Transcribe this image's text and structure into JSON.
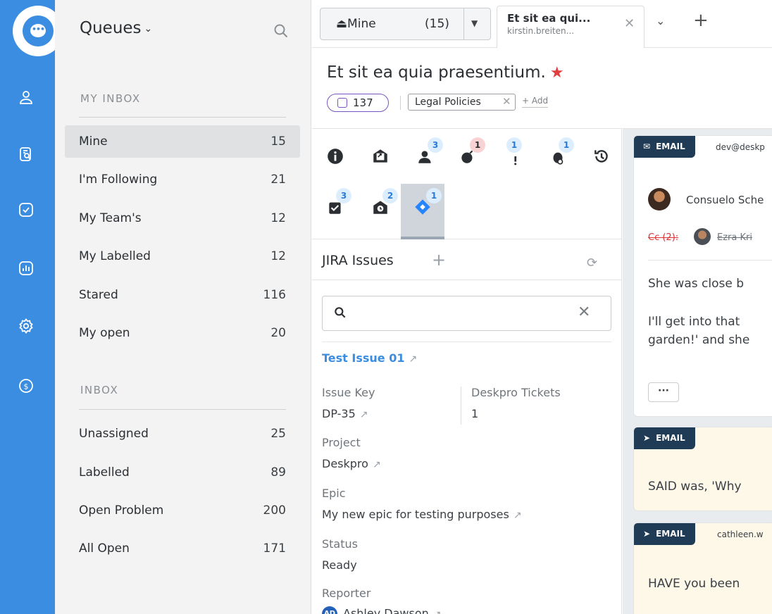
{
  "rail": {
    "icons": [
      "chat-icon",
      "user-icon",
      "tickets-search-icon",
      "tasks-check-icon",
      "reports-icon",
      "settings-icon",
      "billing-icon"
    ]
  },
  "queues": {
    "title": "Queues",
    "my_inbox_label": "MY INBOX",
    "inbox_label": "INBOX",
    "my_inbox": [
      {
        "label": "Mine",
        "count": "15"
      },
      {
        "label": "I'm Following",
        "count": "21"
      },
      {
        "label": "My Team's",
        "count": "12"
      },
      {
        "label": "My Labelled",
        "count": "12"
      },
      {
        "label": "Stared",
        "count": "116"
      },
      {
        "label": "My open",
        "count": "20"
      }
    ],
    "inbox": [
      {
        "label": "Unassigned",
        "count": "25"
      },
      {
        "label": "Labelled",
        "count": "89"
      },
      {
        "label": "Open Problem",
        "count": "200"
      },
      {
        "label": "All Open",
        "count": "171"
      }
    ]
  },
  "tabbar": {
    "mine_label": "⏏Mine",
    "mine_count": "(15)",
    "tab_title": "Et sit ea qui...",
    "tab_subtitle": "kirstin.breiten..."
  },
  "ticket": {
    "title": "Et sit ea quia praesentium.",
    "id_badge": "137",
    "label_chip": "Legal Policies",
    "add_label": "+ Add"
  },
  "app_badges": {
    "users": "3",
    "bomb": "1",
    "alert": "1",
    "bug": "1",
    "check": "3",
    "mail": "2",
    "jira": "1"
  },
  "jira": {
    "heading": "JIRA Issues",
    "issue_title": "Test Issue 01",
    "issue_key_label": "Issue Key",
    "issue_key": "DP-35",
    "tickets_label": "Deskpro Tickets",
    "tickets_value": "1",
    "project_label": "Project",
    "project": "Deskpro",
    "epic_label": "Epic",
    "epic": "My new epic for testing purposes",
    "status_label": "Status",
    "status": "Ready",
    "reporter_label": "Reporter",
    "reporter": "Ashley Dawson"
  },
  "conversation": {
    "email_tag": "EMAIL",
    "card1": {
      "from": "dev@deskp",
      "sender": "Consuelo Sche",
      "cc": "Cc (2):",
      "cc_name": "Ezra Kri",
      "line1": "She was close b",
      "line2": "I'll get into that",
      "line3": "garden!' and she"
    },
    "card2": {
      "line1": "SAID was, 'Why"
    },
    "card3": {
      "from": "cathleen.w",
      "line1": "HAVE you been"
    }
  }
}
